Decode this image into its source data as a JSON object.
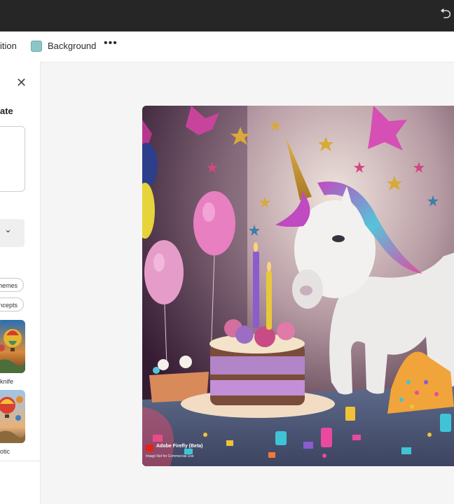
{
  "topbar": {
    "undo_icon": "undo-icon"
  },
  "toolbar": {
    "item_partial": "ition",
    "background_label": "Background",
    "background_color": "#8bc7c6",
    "more_label": "•••"
  },
  "panel": {
    "close_icon": "close-icon",
    "title_partial": "ate",
    "chips": [
      "hemes",
      "ncepts"
    ],
    "thumbnails": [
      {
        "label": "knife",
        "icon": "hot-air-balloon-image"
      },
      {
        "label": "otic",
        "icon": "hot-air-balloon-image"
      }
    ]
  },
  "canvas": {
    "badge_name": "Adobe Firefly (Beta)",
    "badge_sub": "Image Not for Commercial Use"
  }
}
